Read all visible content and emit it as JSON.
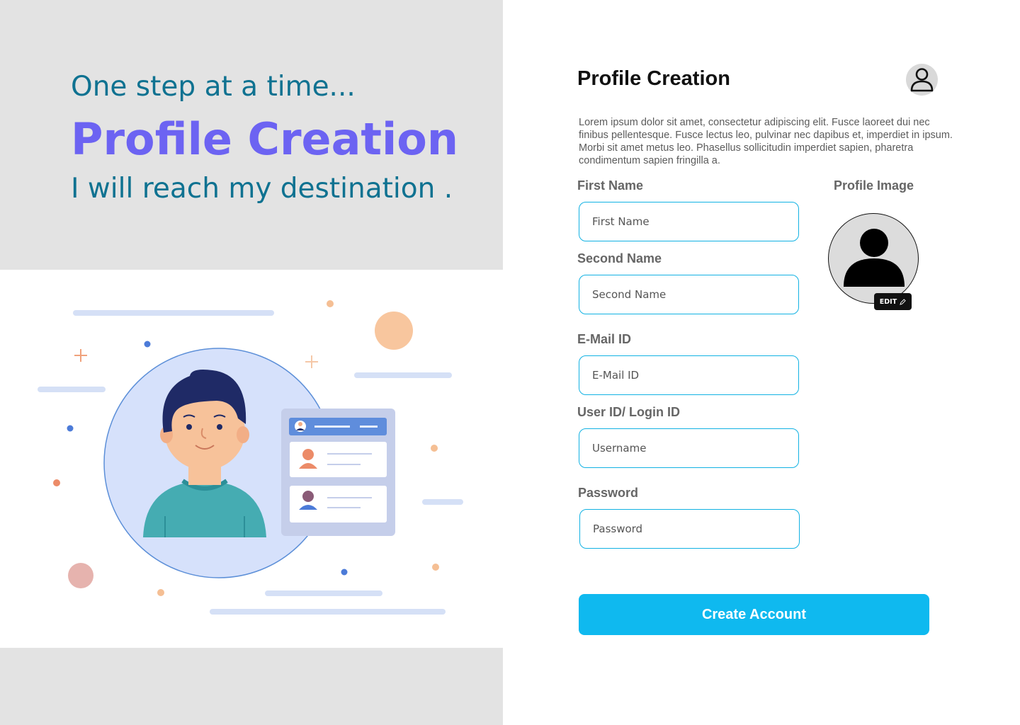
{
  "hero": {
    "tagline": "One step at a time...",
    "title": "Profile Creation",
    "subline": "I will reach my destination ."
  },
  "form": {
    "title": "Profile Creation",
    "description": "Lorem ipsum dolor sit amet, consectetur adipiscing elit. Fusce laoreet dui nec finibus pellentesque. Fusce lectus leo, pulvinar nec dapibus et, imperdiet in ipsum. Morbi sit amet metus leo. Phasellus sollicitudin imperdiet sapien, pharetra condimentum sapien fringilla a.",
    "fields": [
      {
        "label": "First Name",
        "placeholder": "First Name"
      },
      {
        "label": "Second Name",
        "placeholder": "Second Name"
      },
      {
        "label": "E-Mail ID",
        "placeholder": "E-Mail ID"
      },
      {
        "label": "User ID/ Login ID",
        "placeholder": "Username"
      },
      {
        "label": "Password",
        "placeholder": "Password"
      }
    ],
    "profile_image_label": "Profile Image",
    "edit_label": "EDIT",
    "submit_label": "Create Account"
  },
  "colors": {
    "accent": "#0fb9ef",
    "hero_title": "#6c63f2",
    "hero_text": "#0f7291",
    "input_border": "#12b2e3"
  },
  "icons": [
    "user-avatar-icon",
    "person-silhouette-icon",
    "pencil-icon"
  ]
}
